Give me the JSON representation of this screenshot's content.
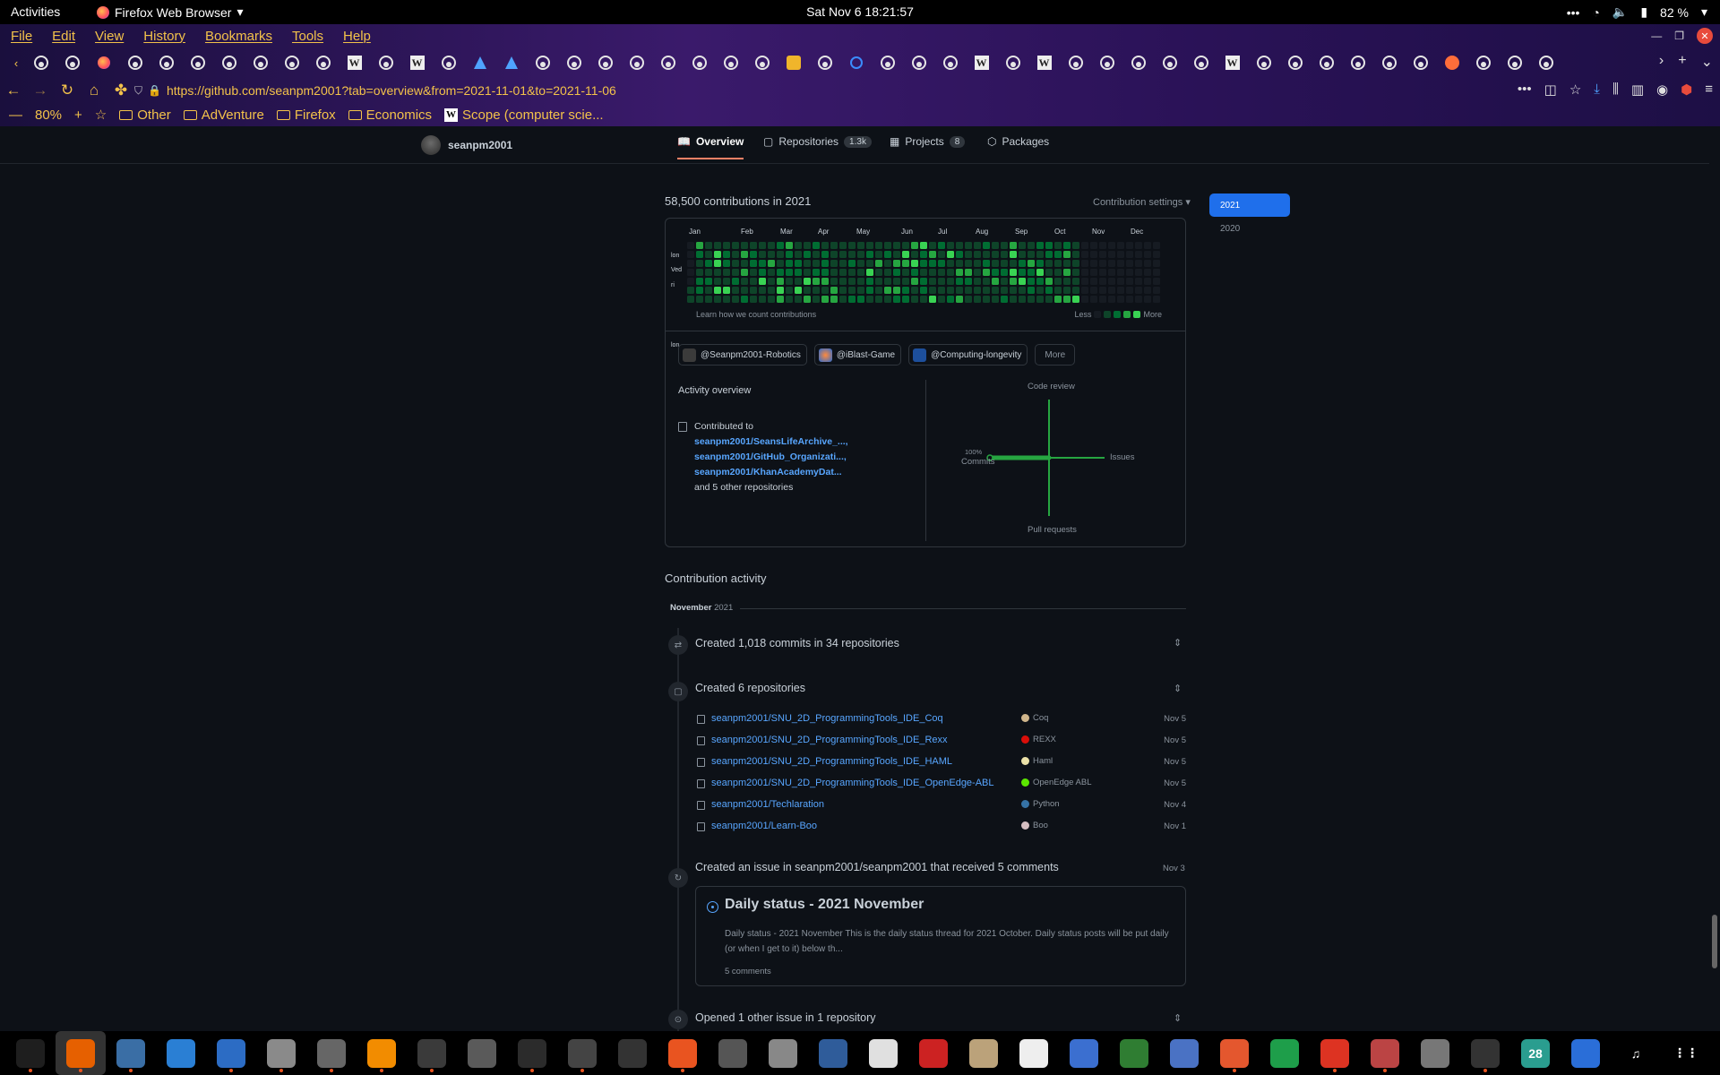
{
  "topbar": {
    "activities": "Activities",
    "app": "Firefox Web Browser",
    "clock": "Sat Nov 6  18:21:57",
    "battery": "82 %"
  },
  "menu": [
    "File",
    "Edit",
    "View",
    "History",
    "Bookmarks",
    "Tools",
    "Help"
  ],
  "url": "https://github.com/seanpm2001?tab=overview&from=2021-11-01&to=2021-11-06",
  "zoom": "80%",
  "bookmarks": {
    "other": "Other",
    "adventure": "AdVenture",
    "firefox": "Firefox",
    "economics": "Economics",
    "scope": "Scope (computer scie..."
  },
  "tab_icons": [
    "github",
    "github",
    "firefox",
    "github",
    "github",
    "github",
    "github",
    "github",
    "github",
    "github",
    "wikipedia",
    "github",
    "wikipedia",
    "github",
    "arch",
    "arch",
    "github",
    "github",
    "github",
    "github",
    "github",
    "github",
    "github",
    "github",
    "puzzle",
    "github",
    "ring",
    "github",
    "github",
    "github",
    "wikipedia",
    "github",
    "wikipedia",
    "github",
    "github",
    "github",
    "github",
    "github",
    "wikipedia",
    "github",
    "github",
    "github",
    "github",
    "github",
    "github",
    "firefox-red",
    "github",
    "github",
    "github"
  ],
  "profile": {
    "username": "seanpm2001",
    "tabs": {
      "overview": "Overview",
      "repositories": "Repositories",
      "repositories_count": "1.3k",
      "projects": "Projects",
      "projects_count": "8",
      "packages": "Packages"
    }
  },
  "contributions": {
    "summary": "58,500 contributions in 2021",
    "settings": "Contribution settings ▾",
    "months": [
      "Jan",
      "Feb",
      "Mar",
      "Apr",
      "May",
      "Jun",
      "Jul",
      "Aug",
      "Sep",
      "Oct",
      "Nov",
      "Dec"
    ],
    "day_labels": [
      "lon",
      "Ved",
      "ri"
    ],
    "learn_link": "Learn how we count contributions",
    "less": "Less",
    "more": "More",
    "active_weeks": 44,
    "total_weeks": 53
  },
  "years": [
    "2021",
    "2020"
  ],
  "orgs": [
    "@Seanpm2001-Robotics",
    "@iBlast-Game",
    "@Computing-longevity"
  ],
  "orgs_more": "More",
  "activity_overview": {
    "title": "Activity overview",
    "contributed_to": "Contributed to",
    "repos": [
      "seanpm2001/SeansLifeArchive_...,",
      "seanpm2001/GitHub_Organizati...,",
      "seanpm2001/KhanAcademyDat..."
    ],
    "others": "and 5 other repositories",
    "axes": {
      "top": "Code review",
      "right": "Issues",
      "bottom": "Pull requests",
      "left": "Commits",
      "left_pct": "100%"
    }
  },
  "chart_data": {
    "type": "scatter",
    "title": "Activity overview",
    "series": [
      {
        "name": "Commits",
        "values": [
          100
        ]
      },
      {
        "name": "Code review",
        "values": [
          0
        ]
      },
      {
        "name": "Issues",
        "values": [
          0
        ]
      },
      {
        "name": "Pull requests",
        "values": [
          0
        ]
      }
    ]
  },
  "activity": {
    "header": "Contribution activity",
    "month": "November",
    "year": "2021",
    "commits_event": "Created 1,018 commits in 34 repositories",
    "repos_event": "Created 6 repositories",
    "created_repos": [
      {
        "name": "seanpm2001/SNU_2D_ProgrammingTools_IDE_Coq",
        "lang": "Coq",
        "color": "#d0b68c",
        "date": "Nov 5"
      },
      {
        "name": "seanpm2001/SNU_2D_ProgrammingTools_IDE_Rexx",
        "lang": "REXX",
        "color": "#d90e09",
        "date": "Nov 5"
      },
      {
        "name": "seanpm2001/SNU_2D_ProgrammingTools_IDE_HAML",
        "lang": "Haml",
        "color": "#ece2a9",
        "date": "Nov 5"
      },
      {
        "name": "seanpm2001/SNU_2D_ProgrammingTools_IDE_OpenEdge-ABL",
        "lang": "OpenEdge ABL",
        "color": "#5ce600",
        "date": "Nov 5"
      },
      {
        "name": "seanpm2001/Techlaration",
        "lang": "Python",
        "color": "#3572a5",
        "date": "Nov 4"
      },
      {
        "name": "seanpm2001/Learn-Boo",
        "lang": "Boo",
        "color": "#d4bec1",
        "date": "Nov 1"
      }
    ],
    "issue_event": "Created an issue in seanpm2001/seanpm2001 that received 5 comments",
    "issue_date": "Nov 3",
    "issue": {
      "title": "Daily status - 2021 November",
      "body": "Daily status - 2021 November This is the daily status thread for 2021 October. Daily status posts will be put daily (or when I get to it) below th...",
      "comments": "5 comments"
    },
    "opened_event": "Opened 1 other issue in 1 repository"
  },
  "dock_apps": [
    "system-monitor",
    "firefox",
    "text-editor",
    "help",
    "notes",
    "files",
    "settings",
    "vlc",
    "puzzle",
    "software-updater",
    "terminal",
    "calculator",
    "system-monitor-graph",
    "app-store",
    "image-viewer",
    "disk-usage",
    "libreoffice-draw",
    "scanner",
    "pdf-viewer",
    "archive",
    "character-map",
    "todo",
    "vim",
    "screen",
    "backup",
    "spreadsheet",
    "alert",
    "game",
    "camera",
    "inkscape",
    "calendar",
    "thunderbird",
    "music",
    "app-grid"
  ],
  "calendar_day": "28"
}
